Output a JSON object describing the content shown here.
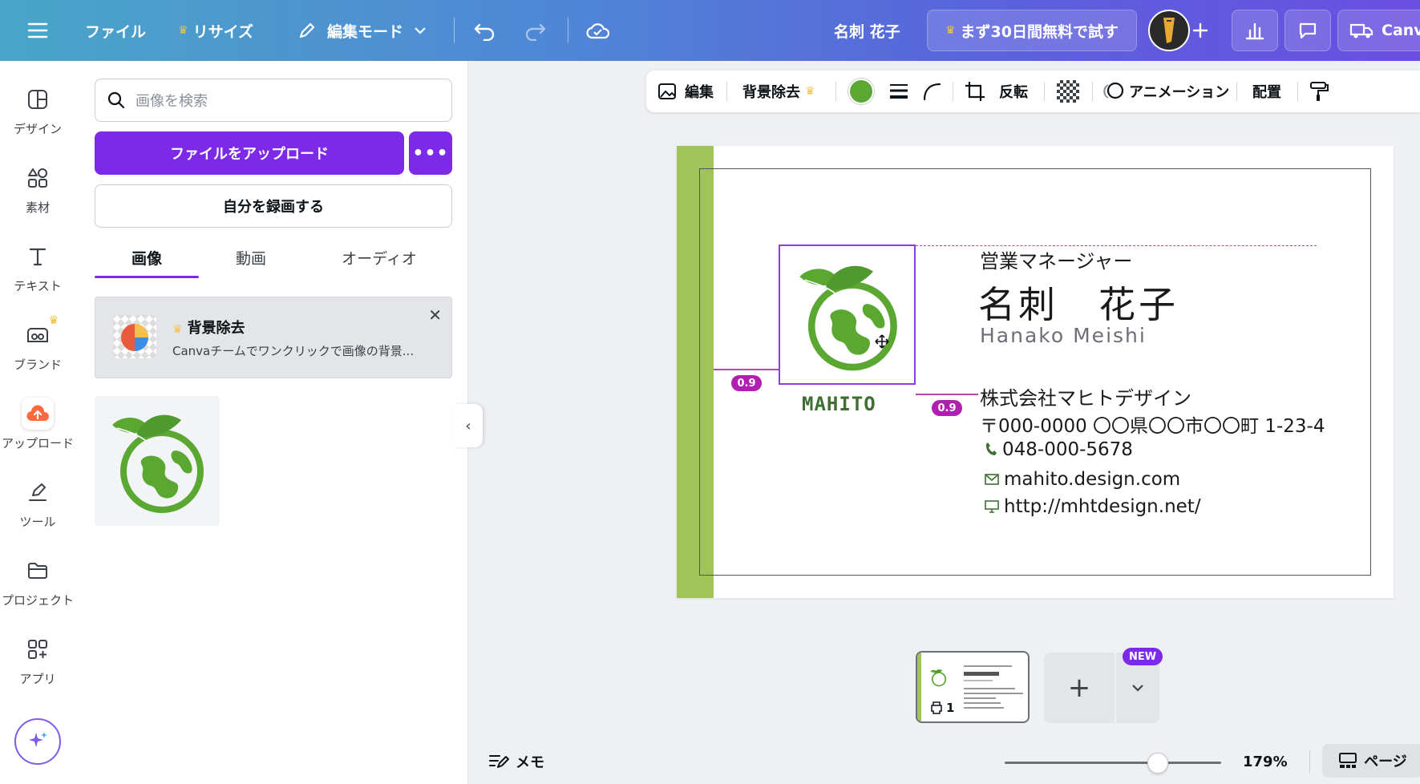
{
  "topbar": {
    "file": "ファイル",
    "resize": "リサイズ",
    "edit_mode": "編集モード",
    "doc_title": "名刺 花子",
    "trial": "まず30日間無料で試す",
    "canva_brand": "Canv"
  },
  "rail": {
    "design": "デザイン",
    "elements": "素材",
    "text": "テキスト",
    "brand": "ブランド",
    "upload": "アップロード",
    "tools": "ツール",
    "projects": "プロジェクト",
    "apps": "アプリ"
  },
  "panel": {
    "search_placeholder": "画像を検索",
    "upload_button": "ファイルをアップロード",
    "record_button": "自分を録画する",
    "tabs": [
      "画像",
      "動画",
      "オーディオ"
    ],
    "promo_title": "背景除去",
    "promo_desc": "Canvaチームでワンクリックで画像の背景..."
  },
  "context_toolbar": {
    "edit": "編集",
    "bg_remove": "背景除去",
    "flip": "反転",
    "animation": "アニメーション",
    "position": "配置",
    "color": "#5aa832"
  },
  "card": {
    "role": "営業マネージャー",
    "name": "名刺　花子",
    "name_roman": "Hanako Meishi",
    "company": "株式会社マヒトデザイン",
    "address": "〒000-0000 〇〇県〇〇市〇〇町 1-23-4",
    "phone": "048-000-5678",
    "email": "mahito.design.com",
    "url": "http://mhtdesign.net/",
    "logo_text": "MAHITO",
    "spacing_left": "0.9",
    "spacing_right": "0.9",
    "accent": "#a0c35a"
  },
  "bottom": {
    "page_number": "1",
    "new_badge": "NEW",
    "memo": "メモ",
    "zoom": "179%",
    "pages": "ページ",
    "zoom_level": 0.55
  }
}
